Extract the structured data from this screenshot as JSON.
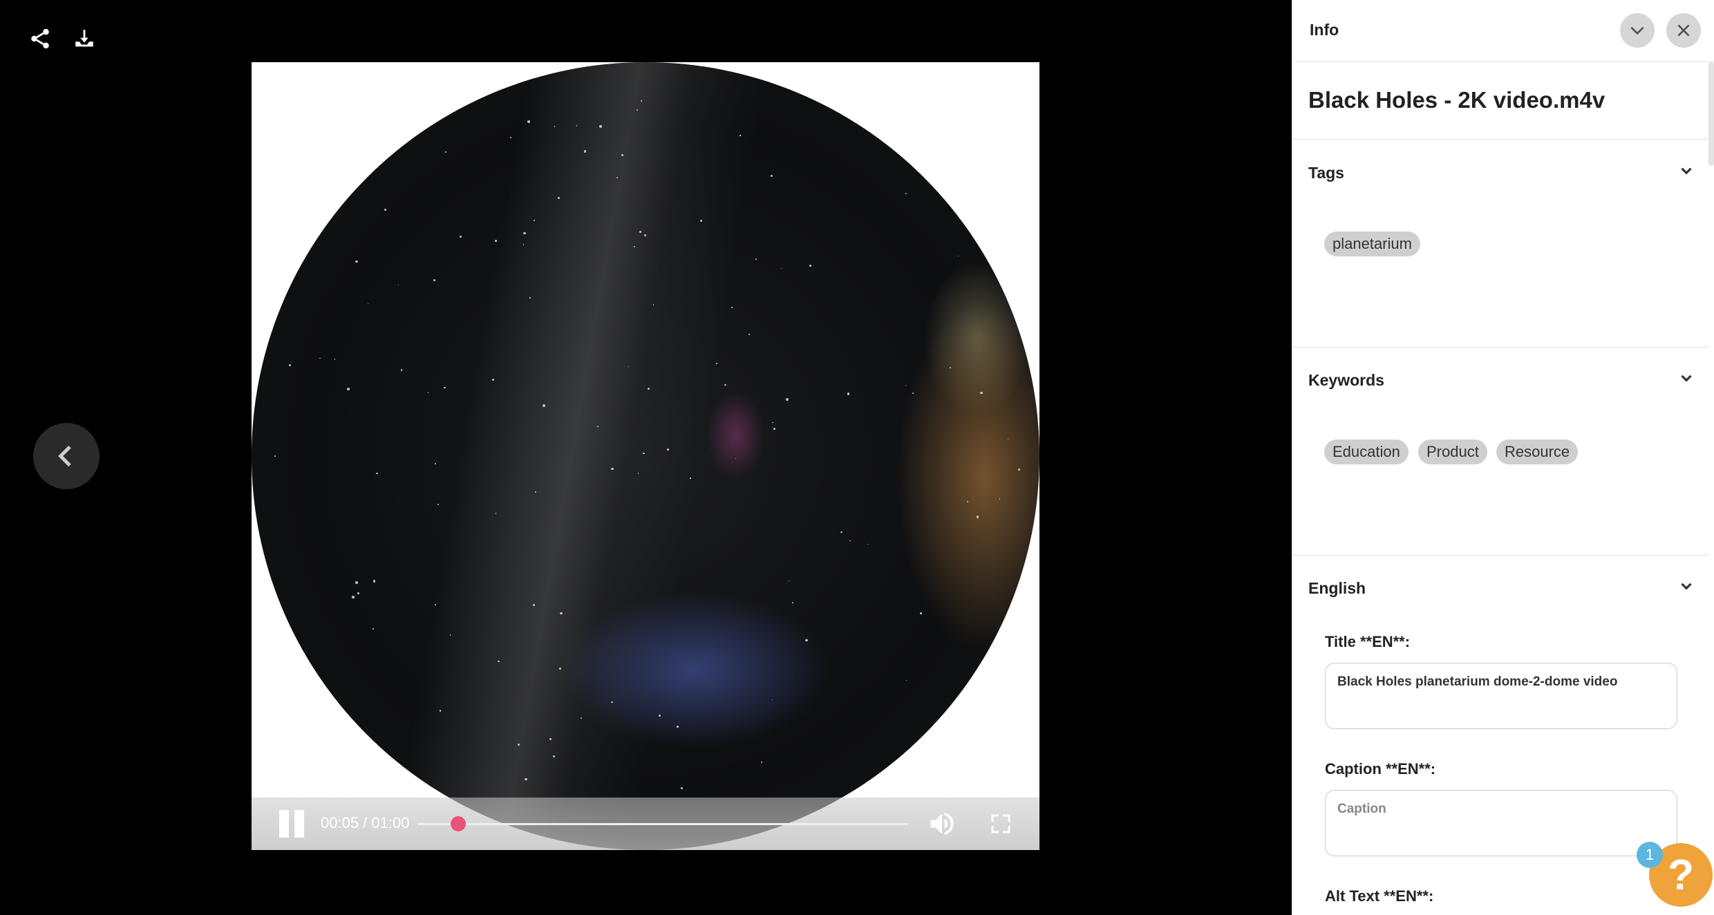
{
  "toolbar": {
    "share_icon": "share-icon",
    "download_icon": "download-icon"
  },
  "nav": {
    "prev_icon": "chevron-left-icon"
  },
  "player": {
    "time": "00:05 / 01:00",
    "progress": 0.083,
    "state": "playing",
    "accent_color": "#e8537a"
  },
  "panel": {
    "header_title": "Info",
    "file_name": "Black Holes - 2K video.m4v",
    "tags": {
      "title": "Tags",
      "items": [
        "planetarium"
      ]
    },
    "keywords": {
      "title": "Keywords",
      "items": [
        "Education",
        "Product",
        "Resource"
      ]
    },
    "english": {
      "title": "English",
      "title_label": "Title **EN**:",
      "title_value": "Black Holes planetarium dome-2-dome video",
      "caption_label": "Caption **EN**:",
      "caption_placeholder": "Caption",
      "alt_label": "Alt Text **EN**:"
    }
  },
  "help": {
    "badge": "1",
    "glyph": "?",
    "color": "#f0a33a"
  }
}
